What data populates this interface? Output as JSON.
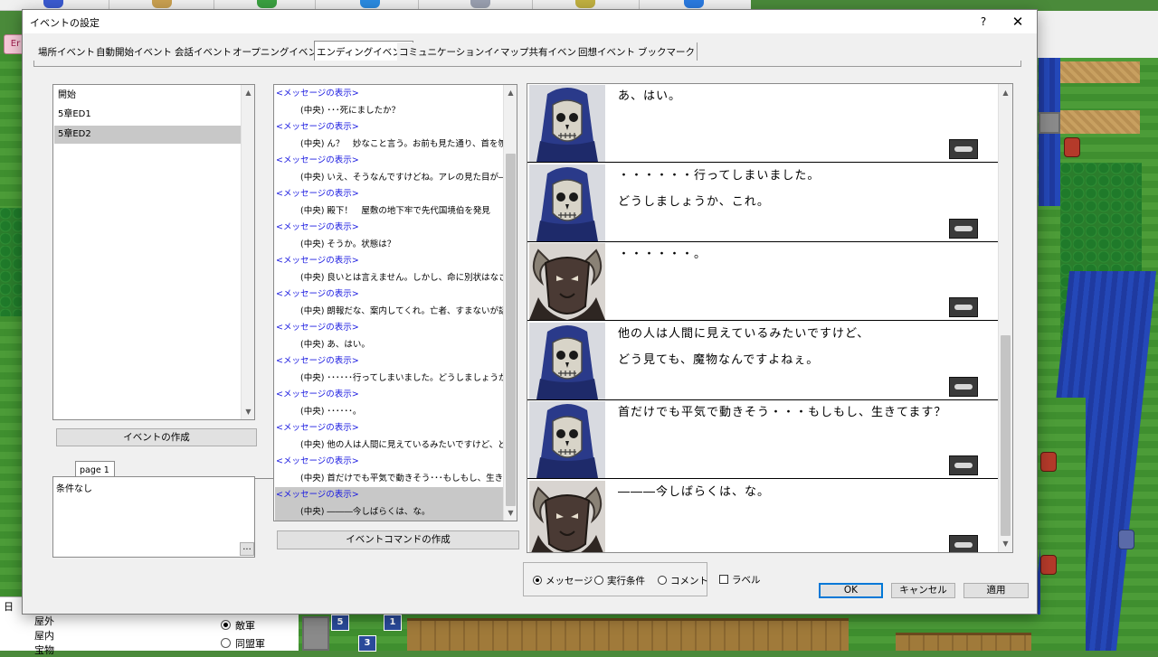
{
  "dialog": {
    "title": "イベントの設定",
    "help_label": "?",
    "close_label": "✕"
  },
  "tabs": [
    {
      "label": "場所イベント"
    },
    {
      "label": "自動開始イベント"
    },
    {
      "label": "会話イベント"
    },
    {
      "label": "オープニングイベント"
    },
    {
      "label": "エンディングイベント",
      "active": true
    },
    {
      "label": "コミュニケーションイベント"
    },
    {
      "label": "マップ共有イベント"
    },
    {
      "label": "回想イベント"
    },
    {
      "label": "ブックマーク"
    }
  ],
  "event_list": {
    "items": [
      {
        "label": "開始"
      },
      {
        "label": "5章ED1"
      },
      {
        "label": "5章ED2",
        "selected": true
      }
    ],
    "create_button": "イベントの作成"
  },
  "page_tab": "page 1",
  "condition": {
    "text": "条件なし",
    "more_button": "..."
  },
  "commands": {
    "rows": [
      {
        "type": "header",
        "text": "<メッセージの表示>"
      },
      {
        "type": "line",
        "text": "(中央) ･･･死にましたか？"
      },
      {
        "type": "header",
        "text": "<メッセージの表示>"
      },
      {
        "type": "line",
        "text": "(中央) ん？　妙なこと言う。お前も見た通り、首を刎ね"
      },
      {
        "type": "header",
        "text": "<メッセージの表示>"
      },
      {
        "type": "line",
        "text": "(中央) いえ、そうなんですけどね。アレの見た目が――"
      },
      {
        "type": "header",
        "text": "<メッセージの表示>"
      },
      {
        "type": "line",
        "text": "(中央) 殿下！　屋敷の地下牢で先代国境伯を発見"
      },
      {
        "type": "header",
        "text": "<メッセージの表示>"
      },
      {
        "type": "line",
        "text": "(中央) そうか。状態は？"
      },
      {
        "type": "header",
        "text": "<メッセージの表示>"
      },
      {
        "type": "line",
        "text": "(中央) 良いとは言えません。しかし、命に別状はなさそ"
      },
      {
        "type": "header",
        "text": "<メッセージの表示>"
      },
      {
        "type": "line",
        "text": "(中央) 朗報だな、案内してくれ。亡者、すまないが話("
      },
      {
        "type": "header",
        "text": "<メッセージの表示>"
      },
      {
        "type": "line",
        "text": "(中央) あ、はい。"
      },
      {
        "type": "header",
        "text": "<メッセージの表示>"
      },
      {
        "type": "line",
        "text": "(中央) ･･････行ってしまいました。どうしましょうか、これ"
      },
      {
        "type": "header",
        "text": "<メッセージの表示>"
      },
      {
        "type": "line",
        "text": "(中央) ･･････。"
      },
      {
        "type": "header",
        "text": "<メッセージの表示>"
      },
      {
        "type": "line",
        "text": "(中央) 他の人は人間に見えているみたいですけど、ど"
      },
      {
        "type": "header",
        "text": "<メッセージの表示>"
      },
      {
        "type": "line",
        "text": "(中央) 首だけでも平気で動きそう･･･もしもし、生きて("
      },
      {
        "type": "header",
        "text": "<メッセージの表示>",
        "selected": true
      },
      {
        "type": "line",
        "text": "(中央) ―――今しばらくは、な。",
        "selected": true
      }
    ],
    "create_button": "イベントコマンドの作成"
  },
  "preview": {
    "messages": [
      {
        "face": "skull-hood",
        "lines": [
          "あ、はい。"
        ]
      },
      {
        "face": "skull-hood",
        "lines": [
          "・・・・・・行ってしまいました。",
          "どうしましょうか、これ。"
        ]
      },
      {
        "face": "horned-beast",
        "lines": [
          "・・・・・・。"
        ]
      },
      {
        "face": "skull-hood",
        "lines": [
          "他の人は人間に見えているみたいですけど、",
          "どう見ても、魔物なんですよねぇ。"
        ]
      },
      {
        "face": "skull-hood",
        "lines": [
          "首だけでも平気で動きそう・・・もしもし、生きてます？"
        ]
      },
      {
        "face": "horned-beast",
        "lines": [
          "―――今しばらくは、な。"
        ]
      }
    ]
  },
  "mode": {
    "options": [
      {
        "label": "メッセージ",
        "checked": true
      },
      {
        "label": "実行条件",
        "checked": false
      },
      {
        "label": "コメント",
        "checked": false
      }
    ],
    "label_checkbox": "ラベル"
  },
  "footer": {
    "ok": "OK",
    "cancel": "キャンセル",
    "apply": "適用"
  },
  "background": {
    "side_tree": [
      "日",
      "屋外",
      "屋内",
      "宝物"
    ],
    "side_radios": [
      {
        "label": "敵軍",
        "checked": true
      },
      {
        "label": "同盟軍",
        "checked": false
      }
    ],
    "map_markers": [
      "5",
      "1",
      "3"
    ],
    "edge_button": "Er"
  },
  "colors": {
    "command_header": "#1a1ae0",
    "selection": "#c8c8c8",
    "face_hood": "#2a3a8a",
    "face_beast": "#4a3a34"
  }
}
